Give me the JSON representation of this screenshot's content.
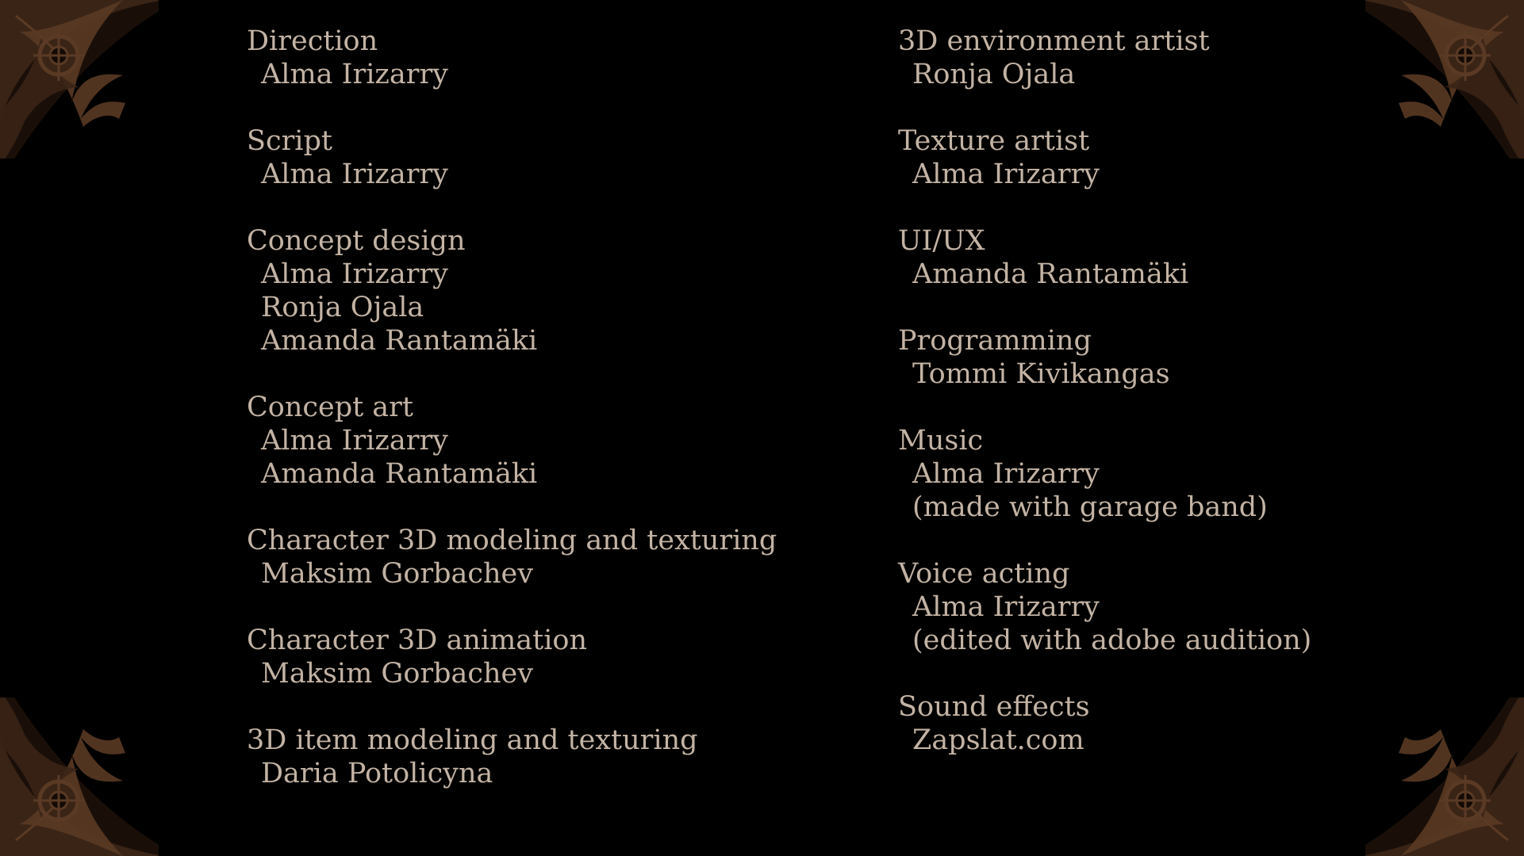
{
  "credits": {
    "left": [
      {
        "role": "Direction",
        "names": [
          "Alma Irizarry"
        ]
      },
      {
        "role": "Script",
        "names": [
          "Alma Irizarry"
        ]
      },
      {
        "role": "Concept design",
        "names": [
          "Alma Irizarry",
          "Ronja Ojala",
          "Amanda Rantamäki"
        ]
      },
      {
        "role": "Concept art",
        "names": [
          "Alma Irizarry",
          "Amanda Rantamäki"
        ]
      },
      {
        "role": "Character 3D modeling and texturing",
        "names": [
          "Maksim Gorbachev"
        ]
      },
      {
        "role": "Character 3D animation",
        "names": [
          "Maksim Gorbachev"
        ]
      },
      {
        "role": "3D item modeling and texturing",
        "names": [
          "Daria Potolicyna"
        ]
      }
    ],
    "right": [
      {
        "role": "3D environment artist",
        "names": [
          "Ronja Ojala"
        ]
      },
      {
        "role": "Texture artist",
        "names": [
          "Alma Irizarry"
        ]
      },
      {
        "role": "UI/UX",
        "names": [
          "Amanda Rantamäki"
        ]
      },
      {
        "role": "Programming",
        "names": [
          "Tommi Kivikangas"
        ]
      },
      {
        "role": "Music",
        "names": [
          "Alma Irizarry",
          "(made with garage band)"
        ]
      },
      {
        "role": "Voice acting",
        "names": [
          "Alma Irizarry",
          "(edited with adobe audition)"
        ]
      },
      {
        "role": "Sound effects",
        "names": [
          "Zapslat.com"
        ]
      }
    ]
  },
  "decorations": {
    "corner_ornament": "gothic-filigree-corner-ornament",
    "ornament_color": "#3a2416",
    "ornament_highlight": "#5a3a24"
  },
  "colors": {
    "background": "#000000",
    "text": "#c3b3a4"
  }
}
